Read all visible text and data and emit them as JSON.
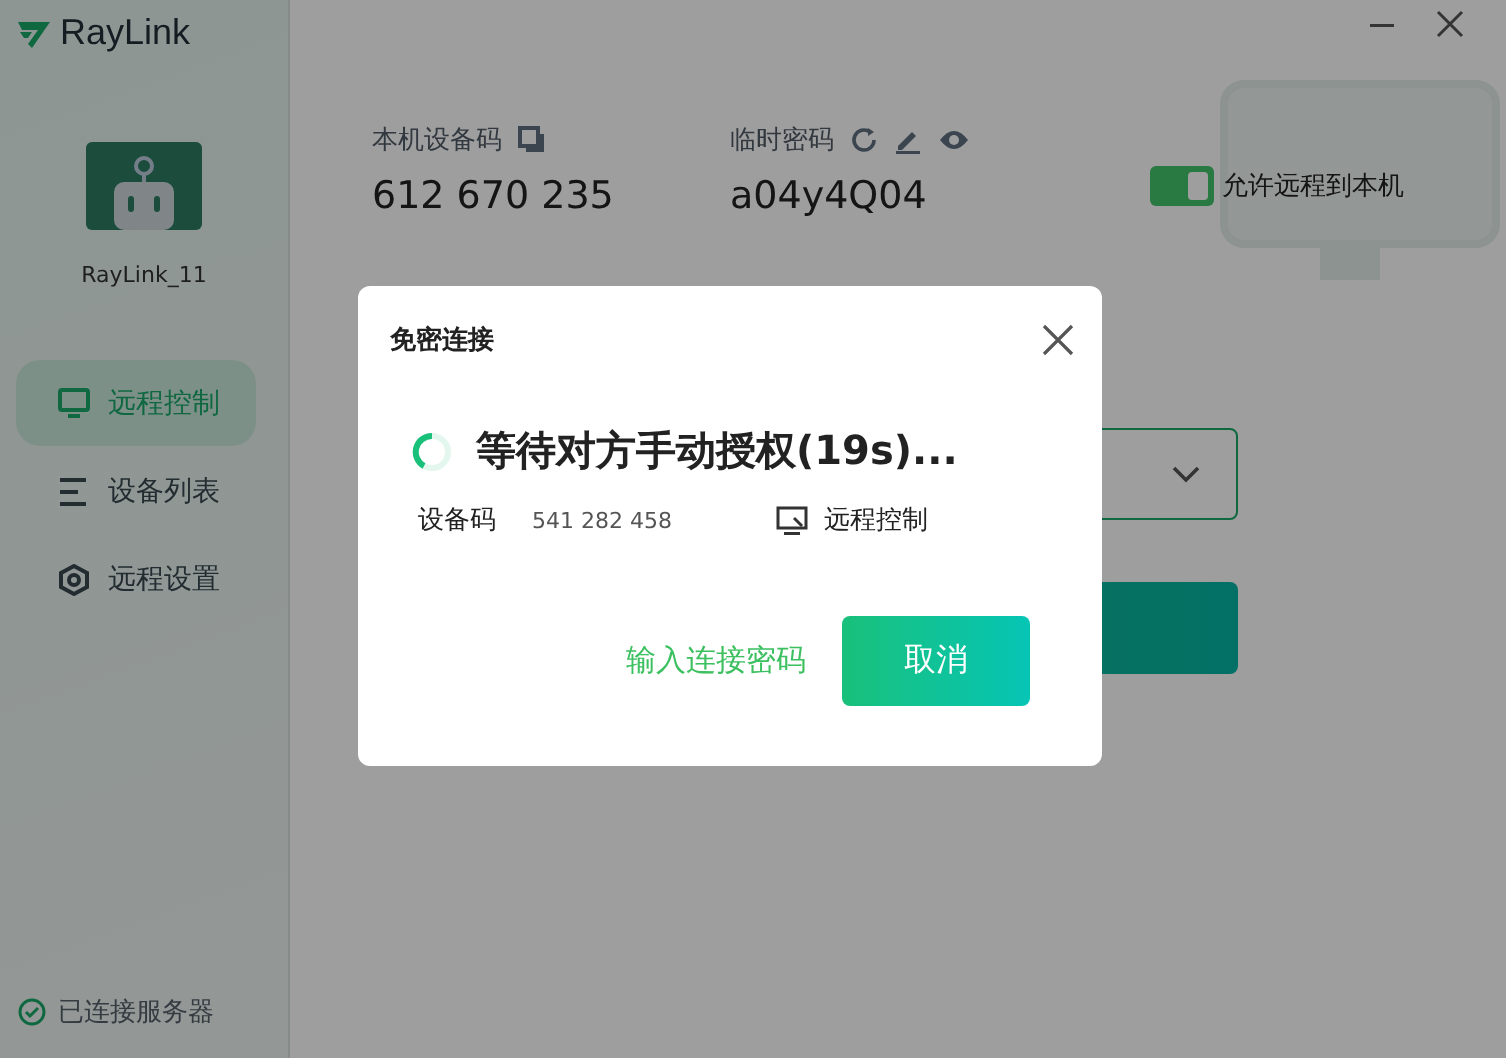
{
  "app": {
    "logo": "RayLink"
  },
  "sidebar": {
    "user_name": "RayLink_11",
    "items": [
      {
        "label": "远程控制",
        "kind": "monitor",
        "selected": true
      },
      {
        "label": "设备列表",
        "kind": "list",
        "selected": false
      },
      {
        "label": "远程设置",
        "kind": "settings",
        "selected": false
      }
    ],
    "status": "已连接服务器"
  },
  "header": {
    "device_code": {
      "label": "本机设备码",
      "value": "612 670 235"
    },
    "temp_password": {
      "label": "临时密码",
      "value": "a04y4Q04"
    },
    "allow_remote": {
      "label": "允许远程到本机",
      "on": true
    }
  },
  "dialog": {
    "title": "免密连接",
    "status": "等待对方手动授权(19s)...",
    "device_label": "设备码",
    "device_code": "541 282 458",
    "mode": "远程控制",
    "link": "输入连接密码",
    "button": "取消"
  }
}
